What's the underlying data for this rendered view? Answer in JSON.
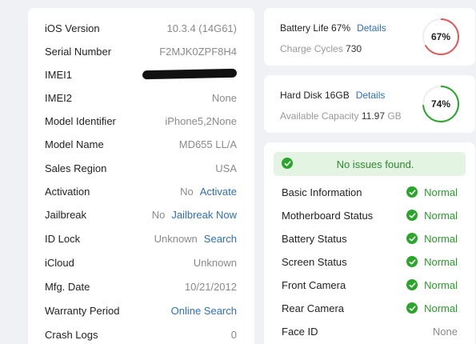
{
  "device_info": [
    {
      "label": "iOS Version",
      "value": "10.3.4 (14G61)"
    },
    {
      "label": "Serial Number",
      "value": "F2MJK0ZPF8H4"
    },
    {
      "label": "IMEI1",
      "value": "",
      "redacted": true
    },
    {
      "label": "IMEI2",
      "value": "None"
    },
    {
      "label": "Model Identifier",
      "value": "iPhone5,2None"
    },
    {
      "label": "Model Name",
      "value": "MD655 LL/A"
    },
    {
      "label": "Sales Region",
      "value": "USA"
    },
    {
      "label": "Activation",
      "value": "No",
      "link": "Activate"
    },
    {
      "label": "Jailbreak",
      "value": "No",
      "link": "Jailbreak Now"
    },
    {
      "label": "ID Lock",
      "value": "Unknown",
      "link": "Search"
    },
    {
      "label": "iCloud",
      "value": "Unknown"
    },
    {
      "label": "Mfg. Date",
      "value": "10/21/2012"
    },
    {
      "label": "Warranty Period",
      "value": "",
      "link": "Online Search"
    },
    {
      "label": "Crash Logs",
      "value": "0"
    }
  ],
  "battery": {
    "title": "Battery Life 67%",
    "details_label": "Details",
    "sub_label": "Charge Cycles",
    "sub_value": "730",
    "percent_label": "67%",
    "percent": 67,
    "ring_color": "#e05a5a"
  },
  "disk": {
    "title": "Hard Disk 16GB",
    "details_label": "Details",
    "sub_label": "Available Capacity",
    "sub_value": "11.97",
    "sub_unit": "GB",
    "percent_label": "74%",
    "percent": 74,
    "ring_color": "#2ba52b"
  },
  "status": {
    "banner": "No issues found.",
    "checks": [
      {
        "label": "Basic Information",
        "status": "Normal",
        "ok": true
      },
      {
        "label": "Motherboard Status",
        "status": "Normal",
        "ok": true
      },
      {
        "label": "Battery Status",
        "status": "Normal",
        "ok": true
      },
      {
        "label": "Screen Status",
        "status": "Normal",
        "ok": true
      },
      {
        "label": "Front Camera",
        "status": "Normal",
        "ok": true
      },
      {
        "label": "Rear Camera",
        "status": "Normal",
        "ok": true
      },
      {
        "label": "Face ID",
        "status": "None",
        "ok": false
      }
    ]
  }
}
